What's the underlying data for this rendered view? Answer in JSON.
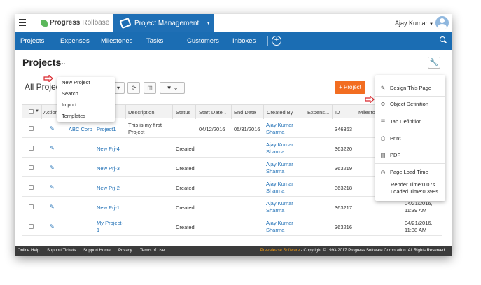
{
  "topbar": {
    "brand_bold": "Progress",
    "brand_light": "Rollbase",
    "app_name": "Project Management",
    "user_name": "Ajay Kumar"
  },
  "nav": {
    "items": [
      "Projects",
      "Expenses",
      "Milestones",
      "Tasks",
      "Customers",
      "Inboxes"
    ]
  },
  "page": {
    "title": "Projects",
    "more": "...",
    "view_title": "All Projec",
    "new_button": "+ Project"
  },
  "more_menu": [
    "New Project",
    "Search",
    "Import",
    "Templates"
  ],
  "table": {
    "headers": [
      "Action",
      "Description",
      "Status",
      "Start Date",
      "End Date",
      "Created By",
      "Expens...",
      "ID",
      "Mileston"
    ],
    "rows": [
      {
        "customer": "ABC Corp",
        "name": "Project1",
        "description": "This is my first Project",
        "status": "",
        "start": "04/12/2016",
        "end": "05/31/2016",
        "created_by": "Ajay Kumar Sharma",
        "id": "346363",
        "date": "",
        "time": ""
      },
      {
        "customer": "",
        "name": "New Prj-4",
        "description": "",
        "status": "Created",
        "start": "",
        "end": "",
        "created_by": "Ajay Kumar Sharma",
        "id": "363220",
        "date": "",
        "time": ""
      },
      {
        "customer": "",
        "name": "New Prj-3",
        "description": "",
        "status": "Created",
        "start": "",
        "end": "",
        "created_by": "Ajay Kumar Sharma",
        "id": "363219",
        "date": "",
        "time": ""
      },
      {
        "customer": "",
        "name": "New Prj-2",
        "description": "",
        "status": "Created",
        "start": "",
        "end": "",
        "created_by": "Ajay Kumar Sharma",
        "id": "363218",
        "date": "",
        "time": ""
      },
      {
        "customer": "",
        "name": "New Prj-1",
        "description": "",
        "status": "Created",
        "start": "",
        "end": "",
        "created_by": "Ajay Kumar Sharma",
        "id": "363217",
        "date": "04/21/2016,",
        "time": "11:39 AM"
      },
      {
        "customer": "",
        "name": "My Project-1",
        "description": "",
        "status": "Created",
        "start": "",
        "end": "",
        "created_by": "Ajay Kumar Sharma",
        "id": "363216",
        "date": "04/21/2016,",
        "time": "11:38 AM"
      }
    ]
  },
  "settings_menu": {
    "items": [
      "Design This Page",
      "Object Definition",
      "Tab Definition",
      "Print",
      "PDF",
      "Page Load Time"
    ],
    "render_time": "Render Time:0.07s",
    "loaded_time": "Loaded Time:0.398s"
  },
  "footer": {
    "links": [
      "Online Help",
      "Support Tickets",
      "Support Home",
      "Privacy",
      "Terms of Use"
    ],
    "prerelease": "Pre-release Software",
    "copyright": " - Copyright © 1993-2017 Progress Software Corporation. All Rights Reserved."
  },
  "colors": {
    "brand_blue": "#1b6db3",
    "accent_orange": "#f26d21",
    "footer_bg": "#3b3b3b"
  }
}
